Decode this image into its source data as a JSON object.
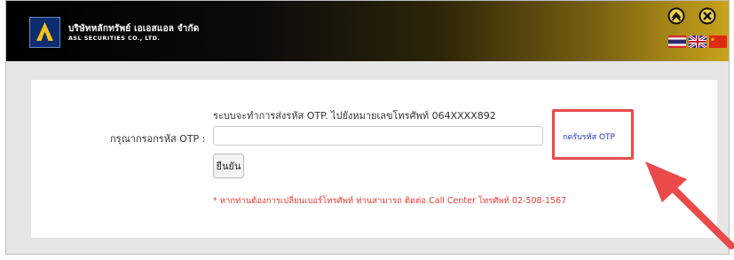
{
  "header": {
    "company_name_th": "บริษัทหลักทรัพย์ เอเอสแอล จำกัด",
    "company_name_en": "ASL SECURITIES CO., LTD.",
    "icons": [
      "home-icon",
      "close-icon"
    ],
    "flags": [
      "thai-flag-icon",
      "uk-flag-icon",
      "china-flag-icon"
    ]
  },
  "form": {
    "info_text": "ระบบจะทำการส่งรหัส OTP. ไปยังหมายเลขโทรศัพท์ 064XXXX892",
    "otp_label": "กรุณากรอกรหัส OTP :",
    "otp_value": "",
    "resend_link": "กดรับรหัส OTP",
    "confirm_button": "ยืนยัน",
    "note": "* หากท่านต้องการเปลี่ยนเบอร์โทรศัพท์ ท่านสามารถ ติดต่อ Call Center โทรศัพท์ 02-508-1567"
  },
  "annotation": {
    "highlight_color": "#ea4a4a"
  }
}
